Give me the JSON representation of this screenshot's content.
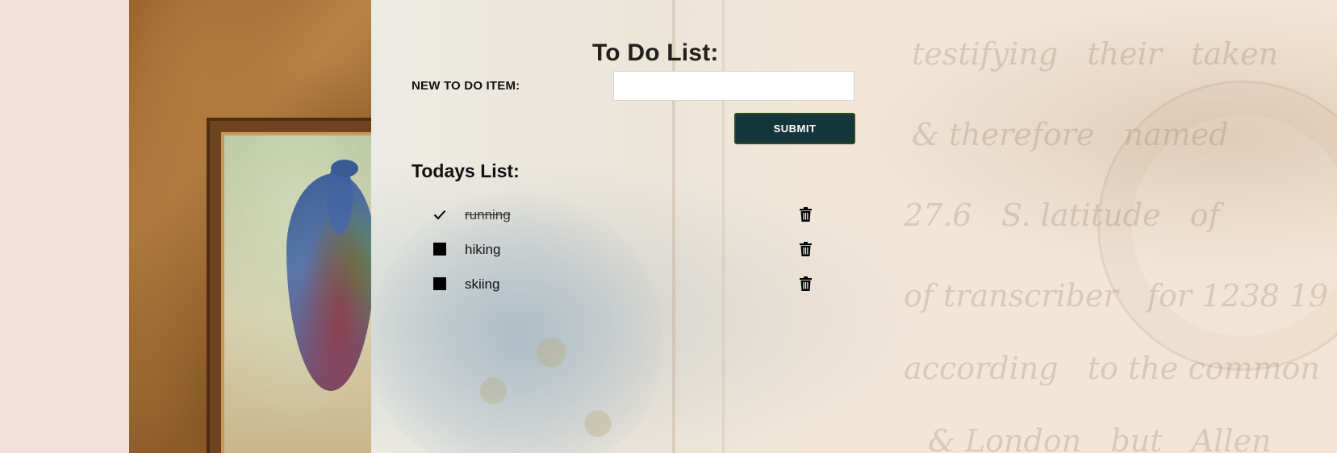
{
  "header": {
    "title": "To Do List:"
  },
  "form": {
    "label": "NEW TO DO ITEM:",
    "input_value": "",
    "input_placeholder": "",
    "submit_label": "SUBMIT"
  },
  "list": {
    "heading": "Todays List:",
    "items": [
      {
        "label": "running",
        "completed": true,
        "check_icon": "checkmark-icon",
        "delete_icon": "trash-icon"
      },
      {
        "label": "hiking",
        "completed": false,
        "check_icon": "square-icon",
        "delete_icon": "trash-icon"
      },
      {
        "label": "skiing",
        "completed": false,
        "check_icon": "square-icon",
        "delete_icon": "trash-icon"
      }
    ]
  },
  "colors": {
    "submit_background": "#143539",
    "page_background": "#f3e0dc",
    "text": "#111111"
  }
}
